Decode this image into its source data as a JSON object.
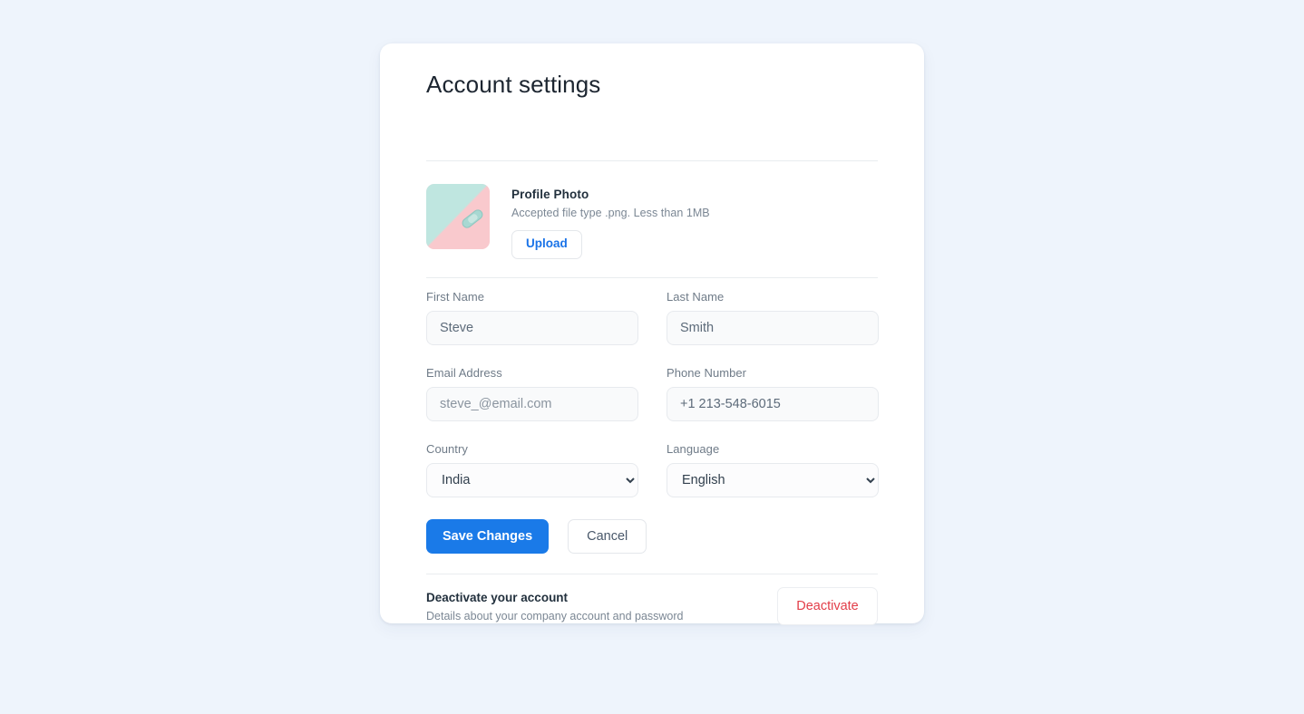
{
  "page": {
    "title": "Account settings",
    "background_color": "#eef4fc",
    "card_background": "#ffffff",
    "accent_color": "#1a7ae8",
    "danger_color": "#e23d48"
  },
  "profile_photo": {
    "title": "Profile Photo",
    "description": "Accepted file type .png. Less than 1MB",
    "upload_label": "Upload",
    "thumbnail_icon": "profile-photo-thumbnail",
    "thumbnail_colors": {
      "top_left": "#bfe6e0",
      "bottom_right": "#f9c9cd",
      "bandaid": "#a8d8d2"
    }
  },
  "form": {
    "first_name": {
      "label": "First Name",
      "value": "Steve",
      "placeholder": "First Name"
    },
    "last_name": {
      "label": "Last Name",
      "value": "Smith",
      "placeholder": "Last Name"
    },
    "email": {
      "label": "Email Address",
      "value": "steve_@email.com",
      "placeholder": "steve_@email.com"
    },
    "phone": {
      "label": "Phone Number",
      "value": "+1 213-548-6015",
      "placeholder": "+1 213-548-6015"
    },
    "country": {
      "label": "Country",
      "selected": "India",
      "options": [
        "India"
      ]
    },
    "language": {
      "label": "Language",
      "selected": "English",
      "options": [
        "English"
      ]
    }
  },
  "actions": {
    "save_label": "Save Changes",
    "cancel_label": "Cancel"
  },
  "deactivate": {
    "title": "Deactivate your account",
    "description": "Details about your company account and password",
    "button_label": "Deactivate"
  }
}
